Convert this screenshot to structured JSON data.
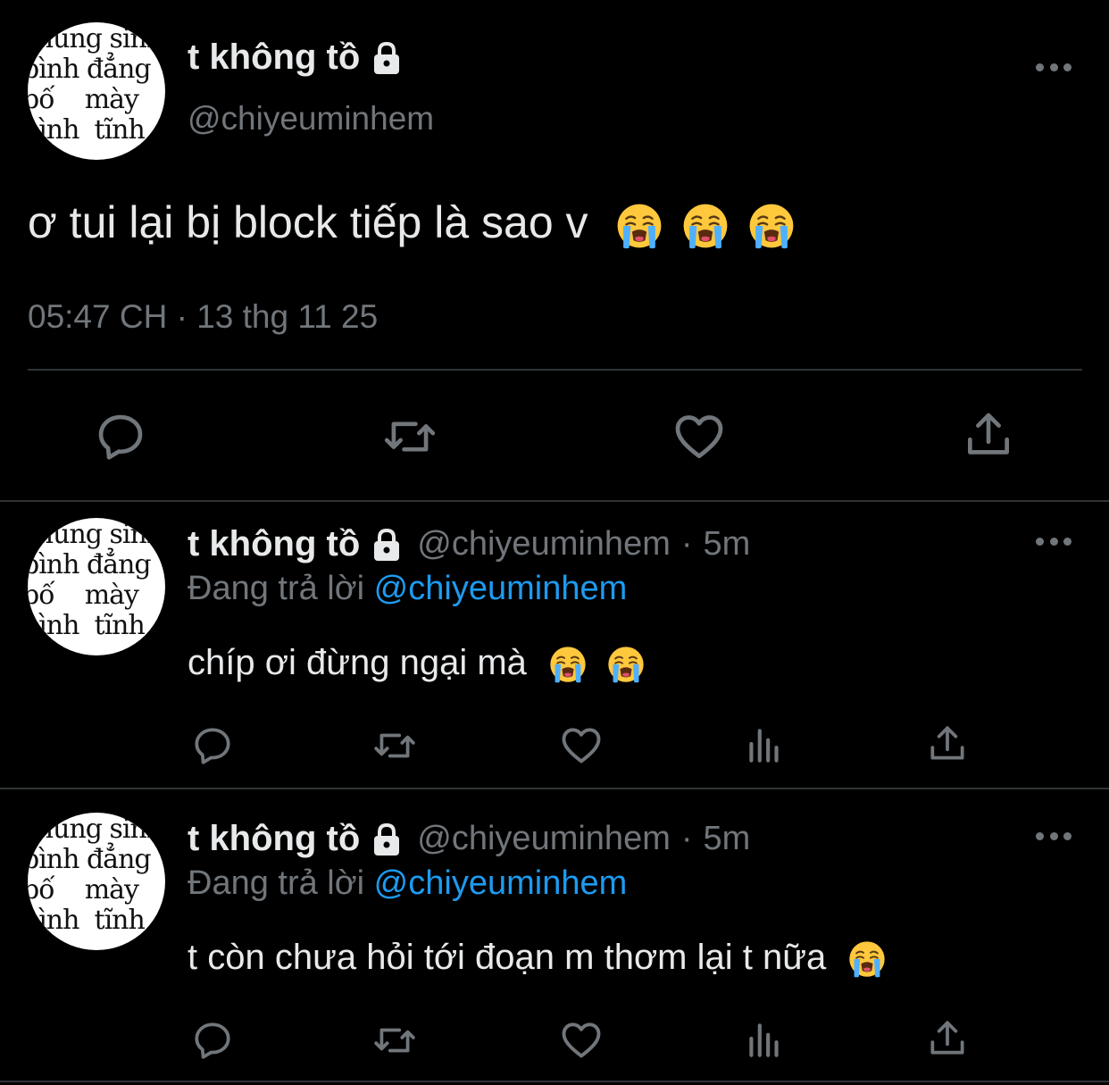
{
  "main_tweet": {
    "display_name": "t không tồ",
    "handle": "@chiyeuminhem",
    "text": "ơ tui lại bị block tiếp là sao v",
    "emojis": [
      "crying-face",
      "crying-face",
      "crying-face"
    ],
    "timestamp": "05:47 CH · 13 thg 11 25",
    "actions": [
      "reply",
      "retweet",
      "like",
      "share"
    ]
  },
  "avatar": {
    "lines": [
      "chúng sinh",
      "bình đẳng",
      "bố    mày",
      "bình  tĩnh"
    ]
  },
  "replies": [
    {
      "display_name": "t không tồ",
      "handle": "@chiyeuminhem",
      "separator": "·",
      "time": "5m",
      "replying_label": "Đang trả lời",
      "replying_to": "@chiyeuminhem",
      "text": "chíp ơi đừng ngại mà",
      "emojis": [
        "crying-face",
        "crying-face"
      ]
    },
    {
      "display_name": "t không tồ",
      "handle": "@chiyeuminhem",
      "separator": "·",
      "time": "5m",
      "replying_label": "Đang trả lời",
      "replying_to": "@chiyeuminhem",
      "text": "t còn chưa hỏi tới đoạn m thơm lại t nữa",
      "emojis": [
        "crying-face"
      ]
    }
  ],
  "colors": {
    "background": "#000000",
    "text_primary": "#e7e9ea",
    "text_secondary": "#71767b",
    "link": "#1d9bf0",
    "divider": "#2f3336"
  }
}
